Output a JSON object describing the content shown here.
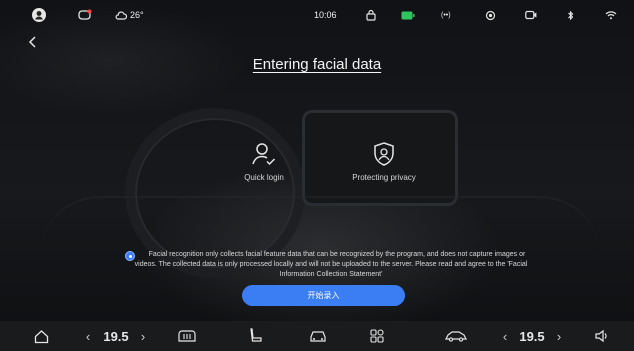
{
  "status_bar": {
    "weather": "26°",
    "time": "10:06"
  },
  "page": {
    "title": "Entering facial data"
  },
  "features": [
    {
      "label": "Quick login",
      "icon": "user-check-icon"
    },
    {
      "label": "Protecting privacy",
      "icon": "shield-face-icon"
    }
  ],
  "consent": {
    "text": "Facial recognition only collects facial feature data that can be recognized by the program, and does not capture images or videos. The collected data is only processed locally and will not be uploaded to the server. Please read and agree to the 'Facial Information Collection Statement'",
    "checked": true
  },
  "start_button": {
    "label": "开始录入"
  },
  "dock": {
    "left_temp": "19.5",
    "right_temp": "19.5"
  },
  "colors": {
    "accent": "#3b7ef4"
  }
}
